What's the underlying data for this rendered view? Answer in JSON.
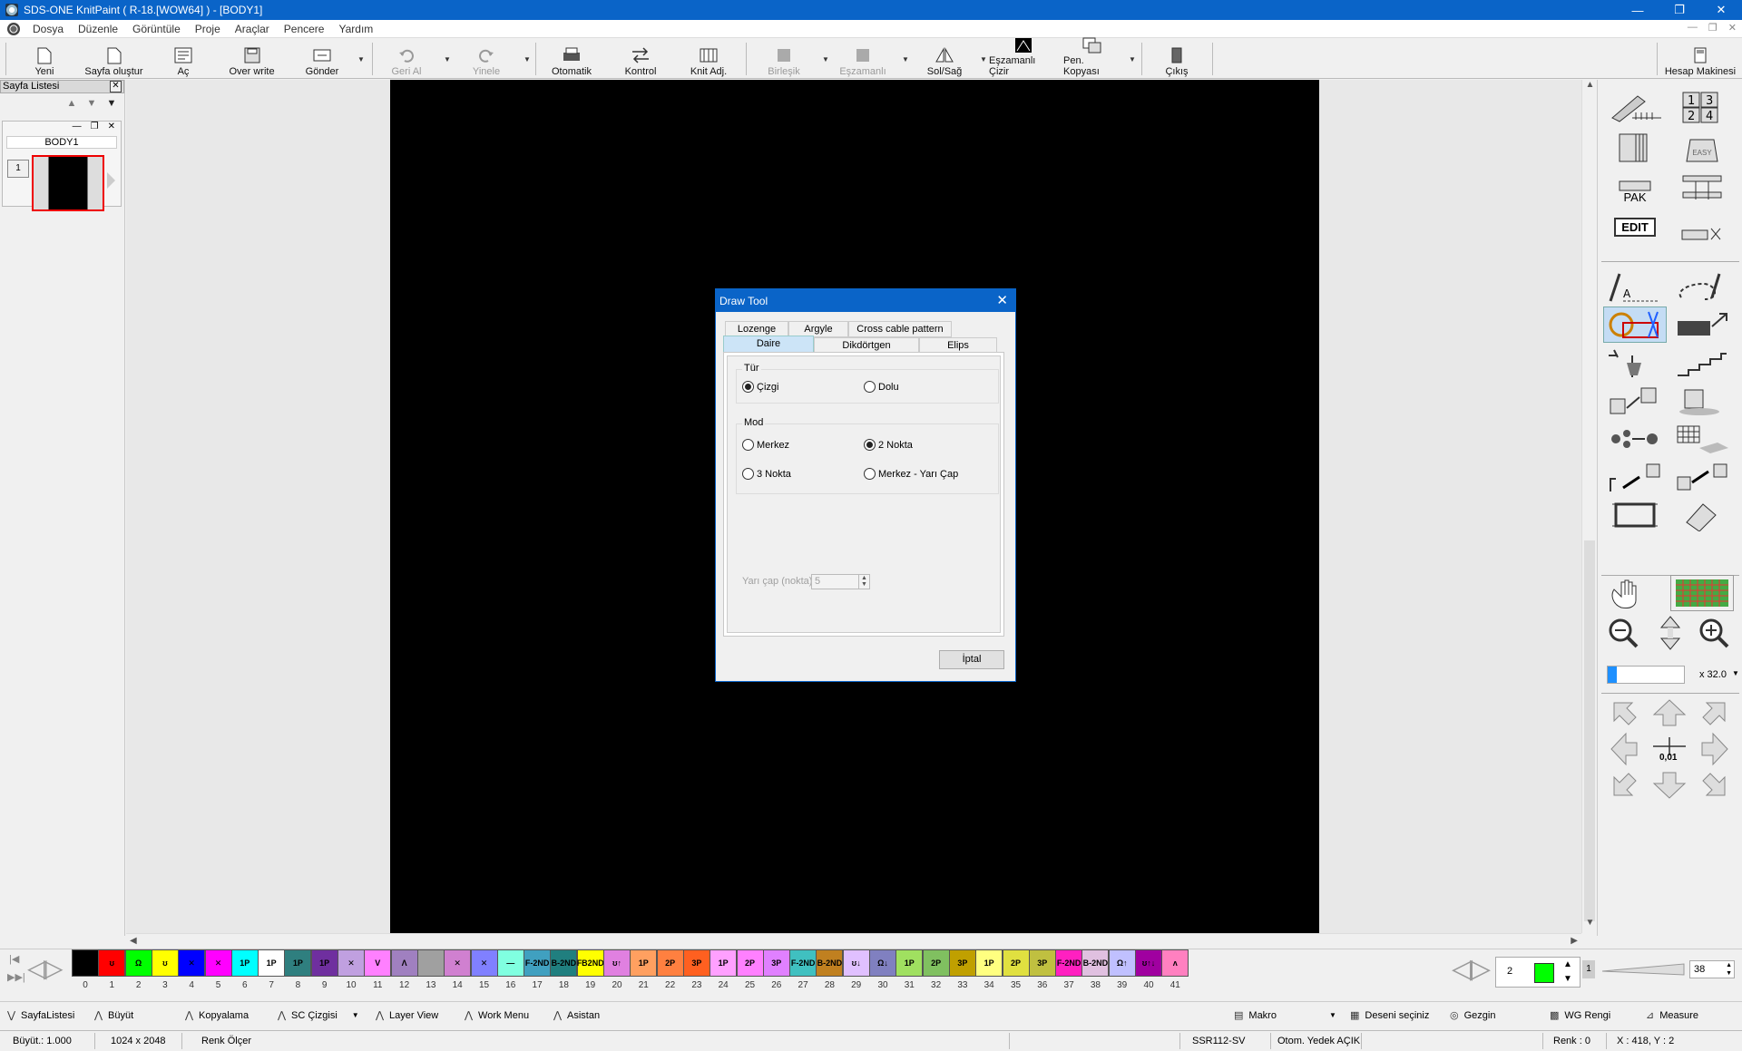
{
  "window": {
    "title": "SDS-ONE KnitPaint ( R-18.[WOW64] ) - [BODY1]"
  },
  "menu": [
    "Dosya",
    "Düzenle",
    "Görüntüle",
    "Proje",
    "Araçlar",
    "Pencere",
    "Yardım"
  ],
  "toolbar": {
    "yeni": "Yeni",
    "sayfa": "Sayfa oluştur",
    "ac": "Aç",
    "overwrite": "Over write",
    "gonder": "Gönder",
    "geri": "Geri Al",
    "yinele": "Yinele",
    "otomatik": "Otomatik",
    "kontrol": "Kontrol",
    "knitadj": "Knit Adj.",
    "birlesik": "Birleşik",
    "eszamanli": "Eşzamanlı",
    "solsag": "Sol/Sağ",
    "eszcizir": "Eşzamanlı Çizir",
    "penkopya": "Pen. Kopyası",
    "cikis": "Çıkış",
    "hesap": "Hesap Makinesi"
  },
  "left_panel": {
    "title": "Sayfa Listesi",
    "page_name": "BODY1",
    "page_num": "1"
  },
  "right_panel": {
    "edit_label": "EDIT",
    "pak_label": "PAK",
    "easy_label": "EASY",
    "zoom": "x 32.0",
    "nudge_label": "0,01"
  },
  "dialog": {
    "title": "Draw Tool",
    "tabs_row1": [
      "Lozenge",
      "Argyle",
      "Cross cable pattern"
    ],
    "tabs_row2": [
      "Daire",
      "Dikdörtgen",
      "Elips"
    ],
    "group_tur": "Tür",
    "tur_options": [
      "Çizgi",
      "Dolu"
    ],
    "group_mod": "Mod",
    "mod_options": [
      "Merkez",
      "2 Nokta",
      "3 Nokta",
      "Merkez - Yarı Çap"
    ],
    "radius_label": "Yarı çap (nokta)",
    "radius_value": "5",
    "cancel": "İptal"
  },
  "colors": {
    "swatches": [
      {
        "n": "0",
        "c": "#000000",
        "t": ""
      },
      {
        "n": "1",
        "c": "#ff0000",
        "t": "ʊ"
      },
      {
        "n": "2",
        "c": "#00ff00",
        "t": "Ω"
      },
      {
        "n": "3",
        "c": "#ffff00",
        "t": "ʊ"
      },
      {
        "n": "4",
        "c": "#0000ff",
        "t": "✕"
      },
      {
        "n": "5",
        "c": "#ff00ff",
        "t": "✕"
      },
      {
        "n": "6",
        "c": "#00ffff",
        "t": "1P"
      },
      {
        "n": "7",
        "c": "#ffffff",
        "t": "1P"
      },
      {
        "n": "8",
        "c": "#2f7f7f",
        "t": "1P"
      },
      {
        "n": "9",
        "c": "#6f2f9f",
        "t": "1P"
      },
      {
        "n": "10",
        "c": "#c0a0e0",
        "t": "✕"
      },
      {
        "n": "11",
        "c": "#ff80ff",
        "t": "V"
      },
      {
        "n": "12",
        "c": "#a080c0",
        "t": "Λ"
      },
      {
        "n": "13",
        "c": "#a0a0a0",
        "t": ""
      },
      {
        "n": "14",
        "c": "#d080d0",
        "t": "✕"
      },
      {
        "n": "15",
        "c": "#8080ff",
        "t": "✕"
      },
      {
        "n": "16",
        "c": "#80ffe0",
        "t": "—"
      },
      {
        "n": "17",
        "c": "#40a0c0",
        "t": "F-2ND"
      },
      {
        "n": "18",
        "c": "#207f7f",
        "t": "B-2ND"
      },
      {
        "n": "19",
        "c": "#ffff00",
        "t": "FB2ND"
      },
      {
        "n": "20",
        "c": "#e080e0",
        "t": "ʊ↑"
      },
      {
        "n": "21",
        "c": "#ffa060",
        "t": "1P"
      },
      {
        "n": "22",
        "c": "#ff8040",
        "t": "2P"
      },
      {
        "n": "23",
        "c": "#ff6020",
        "t": "3P"
      },
      {
        "n": "24",
        "c": "#ffa0ff",
        "t": "1P"
      },
      {
        "n": "25",
        "c": "#ff80ff",
        "t": "2P"
      },
      {
        "n": "26",
        "c": "#e080ff",
        "t": "3P"
      },
      {
        "n": "27",
        "c": "#40c0c0",
        "t": "F-2ND"
      },
      {
        "n": "28",
        "c": "#c08020",
        "t": "B-2ND"
      },
      {
        "n": "29",
        "c": "#e0c0ff",
        "t": "ʊ↓"
      },
      {
        "n": "30",
        "c": "#8080c0",
        "t": "Ω↓"
      },
      {
        "n": "31",
        "c": "#a0e060",
        "t": "1P"
      },
      {
        "n": "32",
        "c": "#80c060",
        "t": "2P"
      },
      {
        "n": "33",
        "c": "#c0a000",
        "t": "3P"
      },
      {
        "n": "34",
        "c": "#ffff80",
        "t": "1P"
      },
      {
        "n": "35",
        "c": "#e0e040",
        "t": "2P"
      },
      {
        "n": "36",
        "c": "#c0c040",
        "t": "3P"
      },
      {
        "n": "37",
        "c": "#ff20c0",
        "t": "F-2ND"
      },
      {
        "n": "38",
        "c": "#e0c0e0",
        "t": "B-2ND"
      },
      {
        "n": "39",
        "c": "#c0c0ff",
        "t": "Ω↑"
      },
      {
        "n": "40",
        "c": "#a000a0",
        "t": "ʊ↑↓"
      },
      {
        "n": "41",
        "c": "#ff80c0",
        "t": "ʌ"
      }
    ],
    "current_num": "2",
    "current_color": "#00ff00",
    "level": "1",
    "level_value": "38"
  },
  "bottombar": {
    "sayfalistesi": "SayfaListesi",
    "buyut": "Büyüt",
    "kopyalama": "Kopyalama",
    "sccizgisi": "SC Çizgisi",
    "layerview": "Layer View",
    "workmenu": "Work Menu",
    "asistan": "Asistan",
    "makro": "Makro",
    "deseni": "Deseni seçiniz",
    "gezgin": "Gezgin",
    "wgrengi": "WG Rengi",
    "measure": "Measure"
  },
  "status": {
    "buyut": "Büyüt.: 1.000",
    "size": "1024 x 2048",
    "renk": "Renk Ölçer",
    "model": "SSR112-SV",
    "yedek": "Otom. Yedek AÇIK",
    "renk_val": "Renk : 0",
    "coords": "X : 418, Y : 2"
  }
}
